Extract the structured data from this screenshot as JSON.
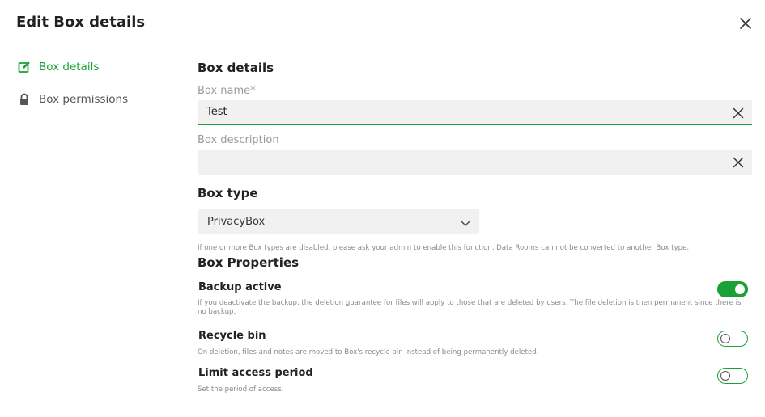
{
  "dialog": {
    "title": "Edit Box details"
  },
  "sidebar": {
    "items": [
      {
        "label": "Box details",
        "icon": "edit-icon",
        "active": true
      },
      {
        "label": "Box permissions",
        "icon": "lock-icon",
        "active": false
      }
    ]
  },
  "form": {
    "section_title": "Box details",
    "name": {
      "label": "Box name*",
      "value": "Test"
    },
    "description": {
      "label": "Box description",
      "value": ""
    },
    "type": {
      "title": "Box type",
      "selected": "PrivacyBox",
      "hint": "If one or more Box types are disabled, please ask your admin to enable this function. Data Rooms can not be converted to another Box type."
    }
  },
  "properties": {
    "title": "Box Properties",
    "backup": {
      "title": "Backup active",
      "desc": "If you deactivate the backup, the deletion guarantee for files will apply to those that are deleted by users. The file deletion is then permanent since there is no backup.",
      "enabled": true
    },
    "recycle": {
      "title": "Recycle bin",
      "desc": "On deletion, files and notes are moved to Box's recycle bin instead of being permanently deleted.",
      "enabled": false
    },
    "limit": {
      "title": "Limit access period",
      "desc": "Set the period of access.",
      "enabled": false
    }
  },
  "colors": {
    "accent": "#1aa135",
    "field_bg": "#f1f1f1"
  }
}
